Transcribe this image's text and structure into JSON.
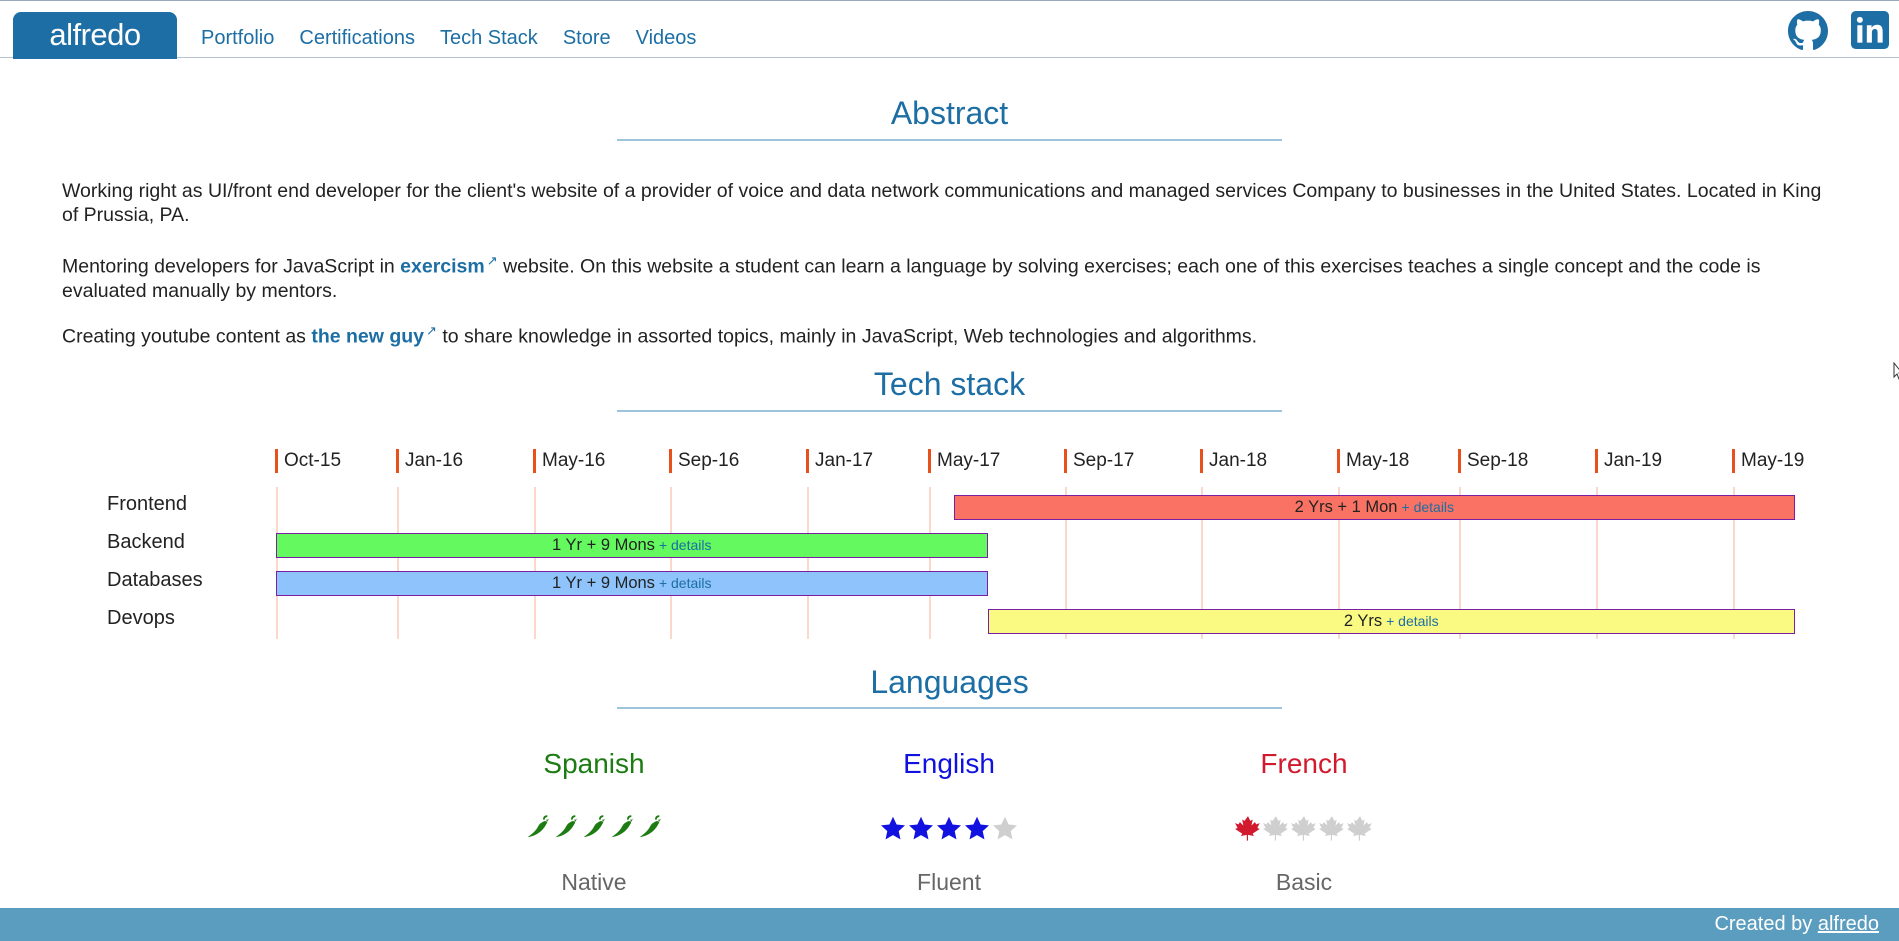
{
  "header": {
    "brand": "alfredo",
    "nav": [
      "Portfolio",
      "Certifications",
      "Tech Stack",
      "Store",
      "Videos"
    ]
  },
  "abstract": {
    "title": "Abstract",
    "p1": "Working right as UI/front end developer for the client's website of a provider of voice and data network communications and managed services Company to businesses in the United States. Located in King of Prussia, PA.",
    "p2_before": "Mentoring developers for JavaScript in ",
    "p2_link": "exercism",
    "p2_after": " website. On this website a student can learn a language by solving exercises; each one of this exercises teaches a single concept and the code is evaluated manually by mentors.",
    "p3_before": "Creating youtube content as ",
    "p3_link": "the new guy",
    "p3_after": " to share knowledge in assorted topics, mainly in JavaScript, Web technologies and algorithms."
  },
  "tech_stack": {
    "title": "Tech stack",
    "ticks": [
      "Oct-15",
      "Jan-16",
      "May-16",
      "Sep-16",
      "Jan-17",
      "May-17",
      "Sep-17",
      "Jan-18",
      "May-18",
      "Sep-18",
      "Jan-19",
      "May-19"
    ],
    "details_label": "+ details",
    "rows": [
      {
        "name": "Frontend",
        "duration": "2 Yrs + 1 Mon",
        "start": "2017-06",
        "end": "2019-07",
        "color": "#fa7263"
      },
      {
        "name": "Backend",
        "duration": "1 Yr + 9 Mons",
        "start": "2015-10",
        "end": "2017-07",
        "color": "#63f95f"
      },
      {
        "name": "Databases",
        "duration": "1 Yr + 9 Mons",
        "start": "2015-10",
        "end": "2017-07",
        "color": "#8fc3fc"
      },
      {
        "name": "Devops",
        "duration": "2 Yrs",
        "start": "2017-07",
        "end": "2019-07",
        "color": "#fafa82"
      }
    ]
  },
  "languages": {
    "title": "Languages",
    "items": [
      {
        "name": "Spanish",
        "level": "Native",
        "rating": 5,
        "icon": "chili-pepper-icon",
        "color": "#1c7c12"
      },
      {
        "name": "English",
        "level": "Fluent",
        "rating": 4,
        "icon": "star-icon",
        "color": "#1212e0"
      },
      {
        "name": "French",
        "level": "Basic",
        "rating": 1,
        "icon": "maple-leaf-icon",
        "color": "#d21a2f"
      }
    ]
  },
  "footer": {
    "prefix": "Created by ",
    "link": "alfredo"
  }
}
